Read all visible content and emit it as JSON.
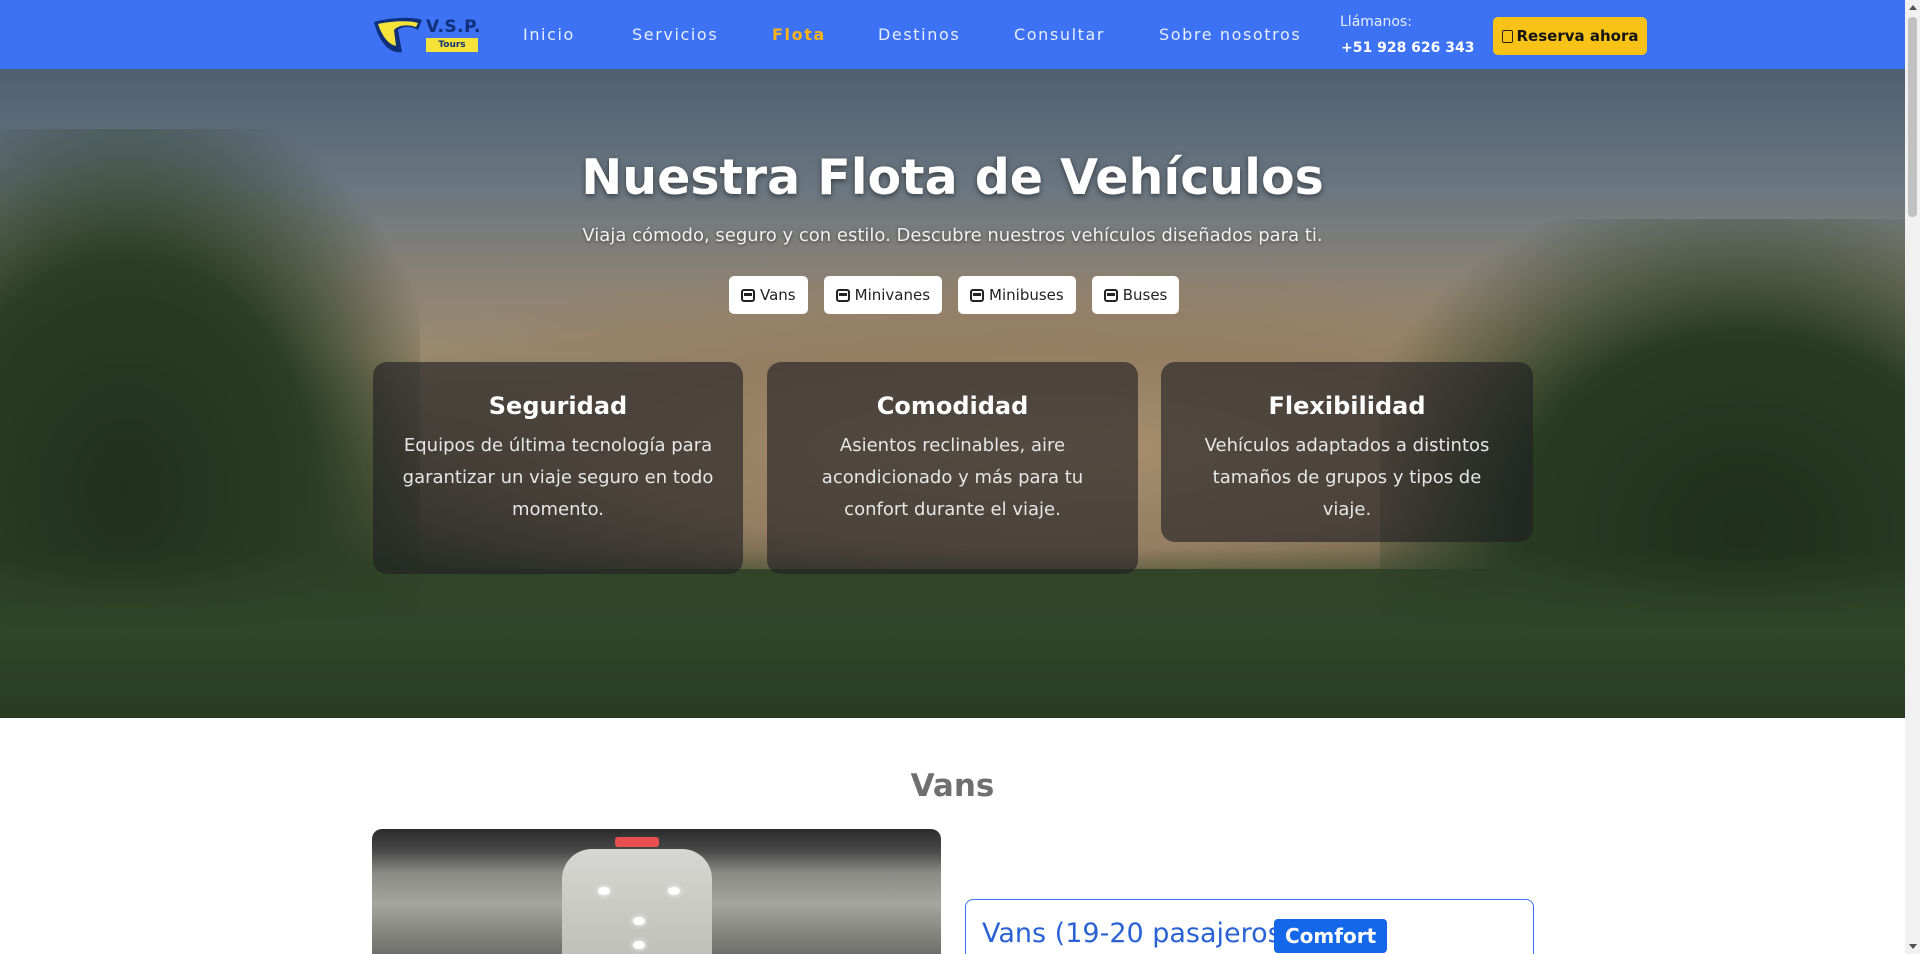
{
  "brand": {
    "name": "V.S.P.",
    "tagline": "Tours",
    "accent": "#3d72f5",
    "highlight": "#f8c316"
  },
  "nav": {
    "items": [
      {
        "label": "Inicio",
        "active": false
      },
      {
        "label": "Servicios",
        "active": false
      },
      {
        "label": "Flota",
        "active": true
      },
      {
        "label": "Destinos",
        "active": false
      },
      {
        "label": "Consultar",
        "active": false
      },
      {
        "label": "Sobre nosotros",
        "active": false
      }
    ],
    "call_label": "Llámanos:",
    "call_phone": "+51 928 626 343",
    "reserve_label": "Reserva ahora",
    "reserve_icon": "calendar-icon"
  },
  "hero": {
    "title": "Nuestra Flota de Vehículos",
    "subtitle": "Viaja cómodo, seguro y con estilo. Descubre nuestros vehículos diseñados para ti.",
    "chips": [
      {
        "label": "Vans",
        "icon": "bus-icon"
      },
      {
        "label": "Minivanes",
        "icon": "bus-icon"
      },
      {
        "label": "Minibuses",
        "icon": "bus-icon"
      },
      {
        "label": "Buses",
        "icon": "bus-icon"
      }
    ],
    "features": [
      {
        "title": "Seguridad",
        "text": "Equipos de última tecnología para garantizar un viaje seguro en todo momento."
      },
      {
        "title": "Comodidad",
        "text": "Asientos reclinables, aire acondicionado y más para tu confort durante el viaje."
      },
      {
        "title": "Flexibilidad",
        "text": "Vehículos adaptados a distintos tamaños de grupos y tipos de viaje."
      }
    ]
  },
  "vans": {
    "section_title": "Vans",
    "card_title": "Vans (19-20 pasajeros)",
    "badge": "Comfort"
  }
}
